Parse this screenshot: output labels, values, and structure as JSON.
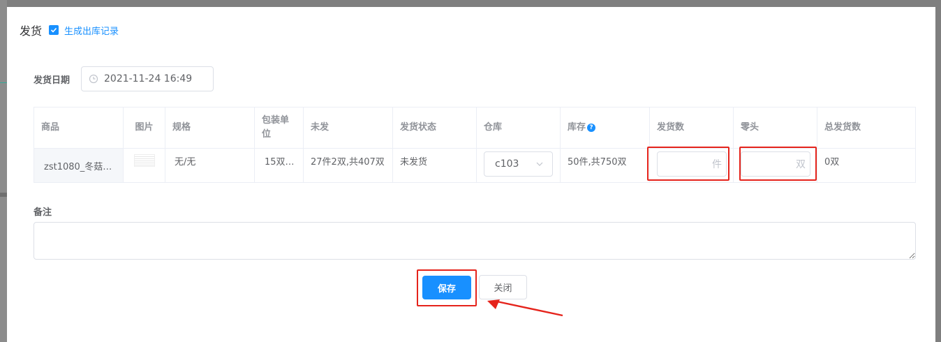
{
  "dialog": {
    "title": "发货",
    "generate_record_checked": true,
    "generate_record_label": "生成出库记录"
  },
  "ship_date": {
    "label": "发货日期",
    "value": "2021-11-24 16:49"
  },
  "table": {
    "headers": {
      "goods": "商品",
      "image": "图片",
      "spec": "规格",
      "pack_unit": "包装单位",
      "unshipped": "未发",
      "status": "发货状态",
      "warehouse": "仓库",
      "stock": "库存",
      "ship_qty": "发货数",
      "loose": "零头",
      "total": "总发货数"
    },
    "row": {
      "goods": "zst1080_冬菇…",
      "spec": "无/无",
      "pack_unit": "15双…",
      "unshipped": "27件2双,共407双",
      "status": "未发货",
      "warehouse": "c103",
      "stock": "50件,共750双",
      "ship_qty_unit": "件",
      "loose_unit": "双",
      "total": "0双"
    }
  },
  "remark": {
    "label": "备注"
  },
  "buttons": {
    "save": "保存",
    "close": "关闭"
  },
  "colors": {
    "primary": "#1890ff",
    "highlight": "#e5231b"
  },
  "icons": [
    "checkbox-checked-icon",
    "clock-icon",
    "help-icon",
    "chevron-down-icon",
    "arrow-annotation-icon"
  ]
}
